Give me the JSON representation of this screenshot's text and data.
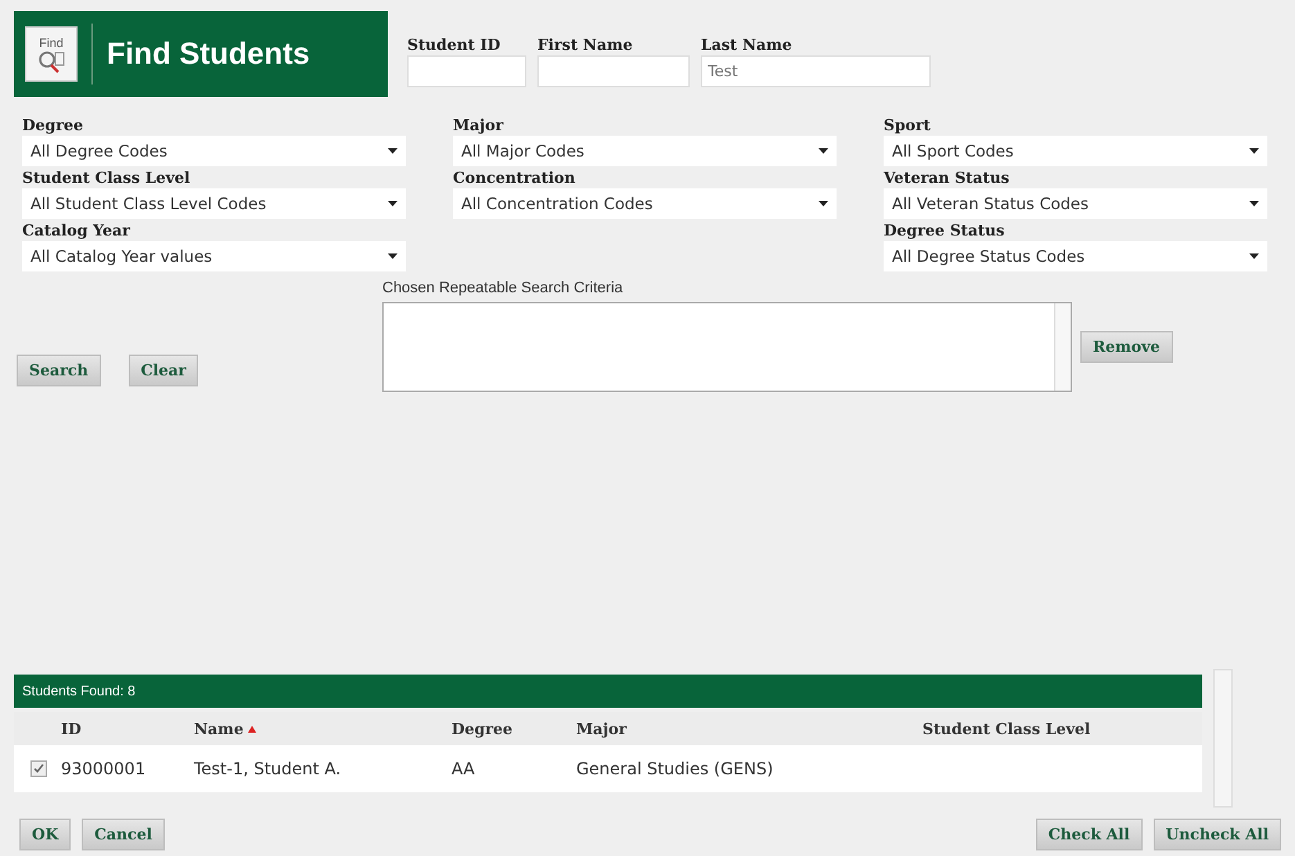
{
  "header": {
    "icon_label": "Find",
    "title": "Find Students"
  },
  "name_fields": [
    {
      "label": "Student ID"
    },
    {
      "label": "First Name"
    },
    {
      "label": "Last Name",
      "placeholder": "Test"
    }
  ],
  "filter_columns": [
    {
      "fields": [
        {
          "label": "Degree",
          "value": "All Degree Codes"
        },
        {
          "label": "Student Class Level",
          "value": "All Student Class Level Codes"
        },
        {
          "label": "Catalog Year",
          "value": "All Catalog Year values"
        }
      ]
    },
    {
      "fields": [
        {
          "label": "Major",
          "value": "All Major Codes"
        },
        {
          "label": "Concentration",
          "value": "All Concentration Codes"
        }
      ]
    },
    {
      "fields": [
        {
          "label": "Sport",
          "value": "All Sport Codes"
        },
        {
          "label": "Veteran Status",
          "value": "All Veteran Status Codes"
        },
        {
          "label": "Degree Status",
          "value": "All Degree Status Codes"
        }
      ]
    }
  ],
  "search_buttons": [
    "Search",
    "Clear"
  ],
  "criteria": {
    "label": "Chosen Repeatable Search Criteria",
    "remove_button": "Remove"
  },
  "results": {
    "title": "Students Found: 8",
    "columns": [
      {
        "label": "ID",
        "sorted": false
      },
      {
        "label": "Name",
        "sorted": true
      },
      {
        "label": "Degree",
        "sorted": false
      },
      {
        "label": "Major",
        "sorted": false
      },
      {
        "label": "Student Class Level",
        "sorted": false
      }
    ],
    "rows": [
      {
        "checked": true,
        "cells": [
          "93000001",
          "Test-1, Student A.",
          "AA",
          "General Studies (GENS)",
          ""
        ]
      }
    ]
  },
  "footer_left": [
    "OK",
    "Cancel"
  ],
  "footer_right": [
    "Check All",
    "Uncheck All"
  ]
}
